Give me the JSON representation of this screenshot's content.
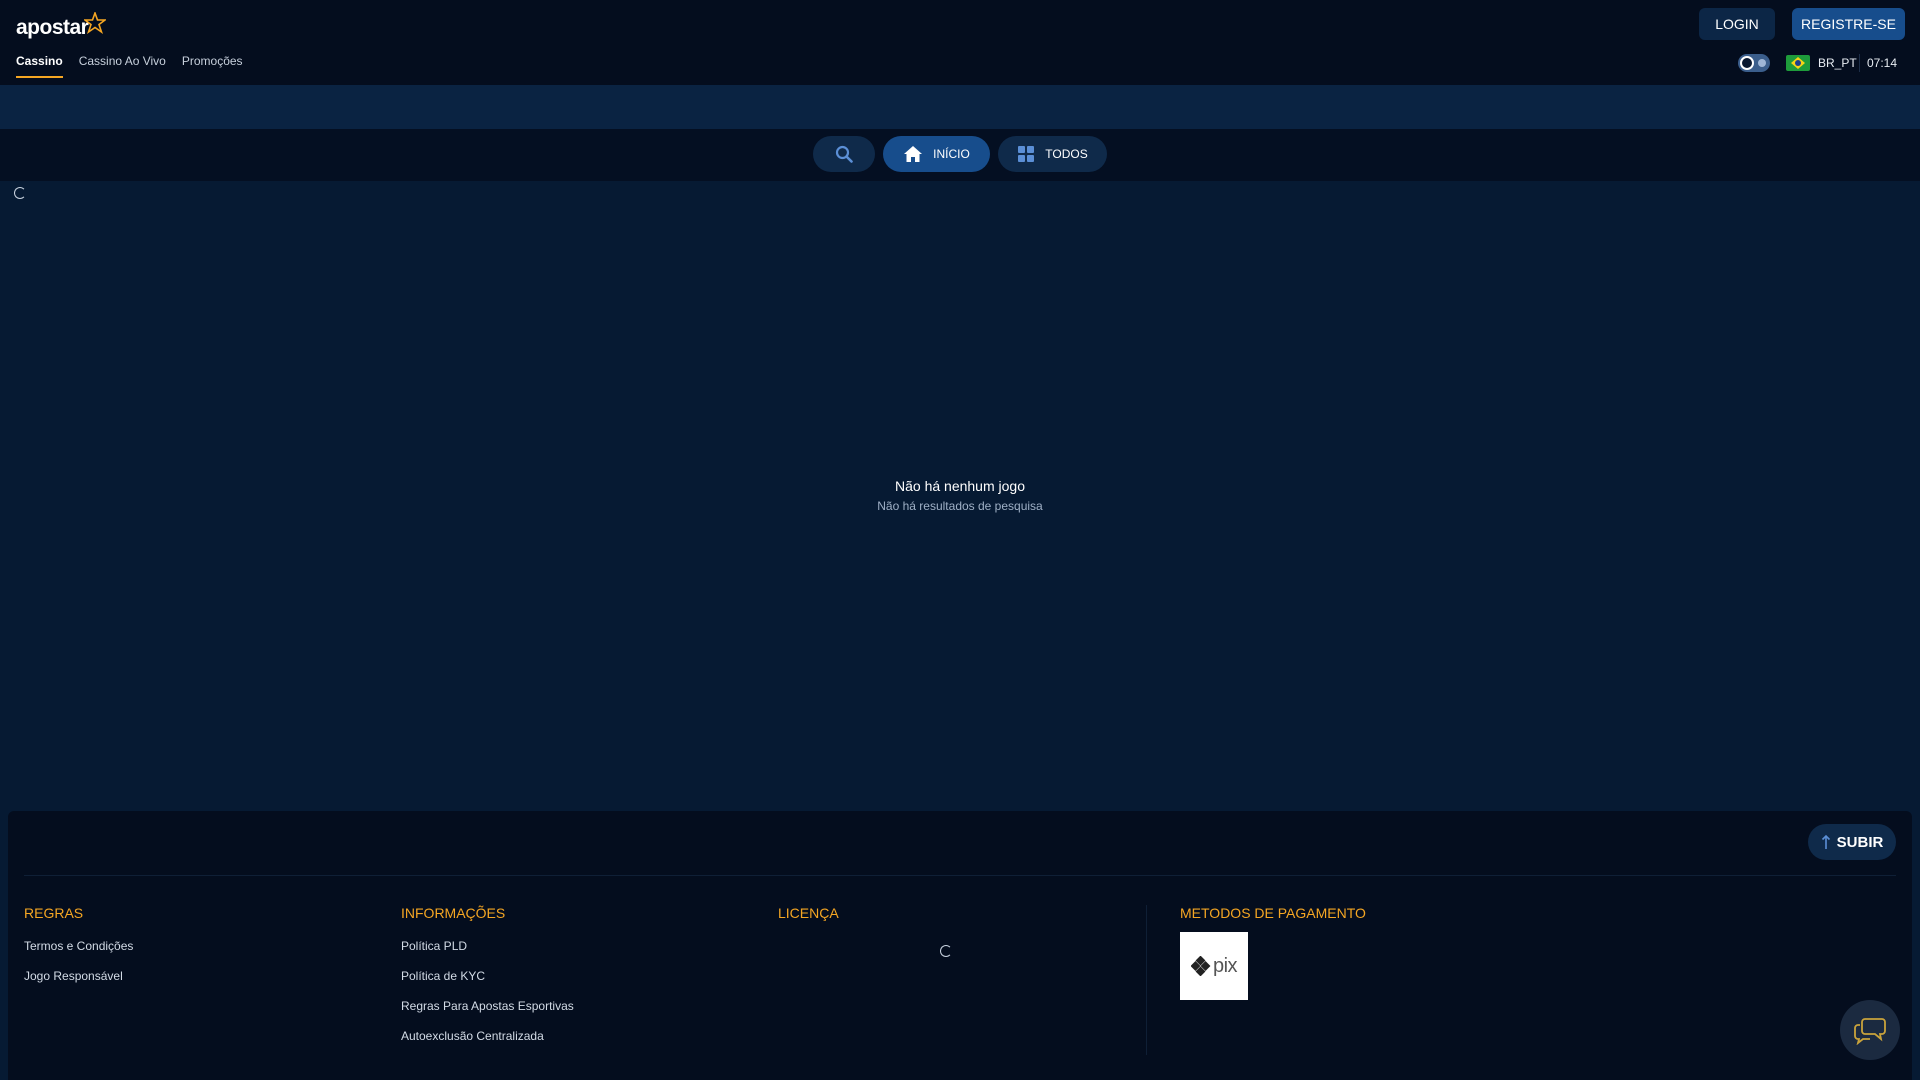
{
  "brand": {
    "name": "apostar",
    "accent": "#f5a623",
    "primary": "#174d8c"
  },
  "nav": {
    "items": [
      {
        "label": "Cassino",
        "active": true
      },
      {
        "label": "Cassino Ao Vivo",
        "active": false
      },
      {
        "label": "Promoções",
        "active": false
      }
    ]
  },
  "header": {
    "login_label": "LOGIN",
    "register_label": "REGISTRE-SE",
    "locale": "BR_PT",
    "time": "07:14",
    "theme_toggle_icon": "moon-sun-toggle-icon",
    "flag_icon": "brazil-flag-icon"
  },
  "tabs": {
    "search_icon": "search-icon",
    "home_label": "INÍCIO",
    "all_label": "TODOS"
  },
  "main": {
    "empty_title": "Não há nenhum jogo",
    "empty_subtitle": "Não há resultados de pesquisa"
  },
  "footer": {
    "up_label": "SUBIR",
    "columns": {
      "rules": {
        "title": "REGRAS",
        "links": [
          "Termos e Condições",
          "Jogo Responsável"
        ]
      },
      "info": {
        "title": "INFORMAÇÕES",
        "links": [
          "Política PLD",
          "Política de KYC",
          "Regras Para Apostas Esportivas",
          "Autoexclusão Centralizada"
        ]
      },
      "license": {
        "title": "LICENÇA"
      },
      "payment": {
        "title": "METODOS DE PAGAMENTO",
        "methods": [
          "pix"
        ]
      }
    }
  }
}
